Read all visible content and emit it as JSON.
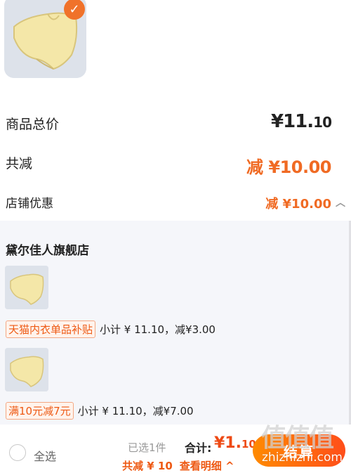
{
  "summary": {
    "total_label": "商品总价",
    "total_main": "¥11.",
    "total_cents": "10",
    "discount_label": "共减",
    "discount_value": "减 ¥10.00",
    "store_discount_label": "店铺优惠",
    "store_discount_value": "减 ¥10.00"
  },
  "store": {
    "name": "黛尔佳人旗舰店",
    "items": [
      {
        "tag": "天猫内衣单品补贴",
        "subtotal": "小计 ¥ 11.10，减¥3.00"
      },
      {
        "tag": "满10元减7元",
        "subtotal": "小计 ¥ 11.10，减¥7.00"
      }
    ]
  },
  "bottom_bar": {
    "select_all": "全选",
    "selected_count": "已选1件",
    "sum_label": "合计:",
    "sum_main": "¥1.",
    "sum_cents": "10",
    "save_text": "共减 ¥ 10",
    "detail_text": "查看明细 ^",
    "checkout": "结算"
  },
  "watermark": {
    "logo": "值值值",
    "url": "zhizhizhi.com"
  },
  "colors": {
    "accent": "#f06a23",
    "checkout_start": "#ff8a00",
    "checkout_end": "#ff4e1a",
    "panel_bg": "#f5f6fa"
  },
  "icons": [
    "checkmark-icon",
    "chevron-up-icon",
    "radio-icon"
  ]
}
